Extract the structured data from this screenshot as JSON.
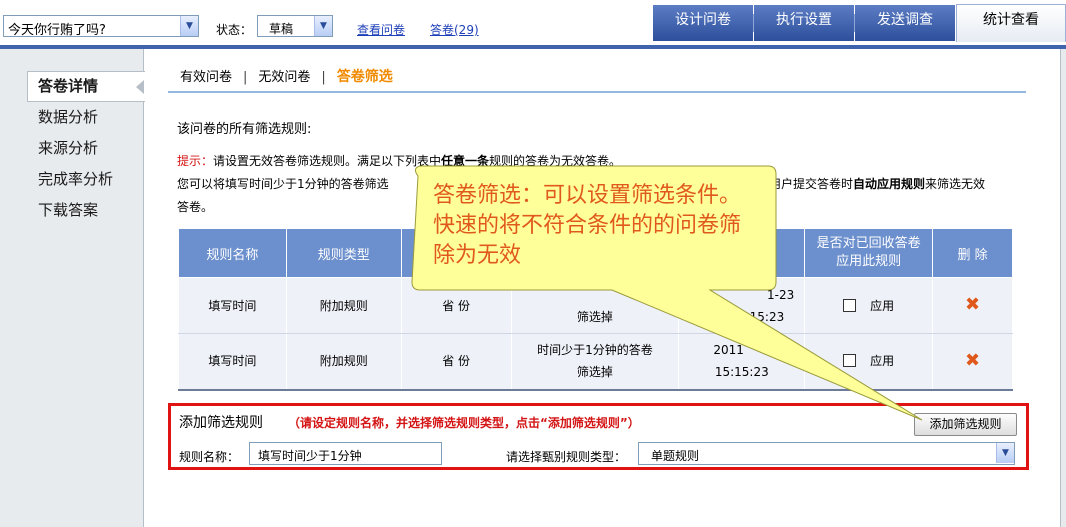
{
  "topbar": {
    "survey_select_value": "今天你行贿了吗?",
    "status_label": "状态：",
    "status_value": "草稿",
    "view_survey_link": "查看问卷",
    "answers_link": "答卷(29)",
    "tabs": [
      {
        "label": "设计问卷"
      },
      {
        "label": "执行设置"
      },
      {
        "label": "发送调查"
      },
      {
        "label": "统计查看"
      }
    ]
  },
  "sidebar": {
    "items": [
      {
        "label": "答卷详情"
      },
      {
        "label": "数据分析"
      },
      {
        "label": "来源分析"
      },
      {
        "label": "完成率分析"
      },
      {
        "label": "下载答案"
      }
    ]
  },
  "subtabs": [
    {
      "label": "有效问卷"
    },
    {
      "label": "无效问卷"
    },
    {
      "label": "答卷筛选"
    }
  ],
  "section_title": "该问卷的所有筛选规则:",
  "tip": {
    "label": "提示：",
    "line1_a": "请设置无效答卷筛选规则。满足以下列表中",
    "line1_b": "任意一条",
    "line1_c": "规则的答卷为无效答卷。",
    "line2_a": "您可以将填写时间少于1分钟的答卷筛选",
    "line2_b": "在用户提交答卷时",
    "line2_c": "自动应用规则",
    "line2_d": "来筛选无效",
    "line3": "答卷。"
  },
  "table": {
    "headers": [
      "规则名称",
      "规则类型",
      "",
      "",
      "",
      "是否对已回收答卷\n应用此规则",
      "删 除"
    ],
    "rows": [
      {
        "name": "填写时间",
        "type": "附加规则",
        "province": "省 份",
        "desc": "筛选掉",
        "time_top": "1-23",
        "time_bottom": "15:23",
        "apply": "应用",
        "delete": "✖"
      },
      {
        "name": "填写时间",
        "type": "附加规则",
        "province": "省 份",
        "desc": "时间少于1分钟的答卷\n筛选掉",
        "time_top": "2011",
        "time_bottom": "15:15:23",
        "apply": "应用",
        "delete": "✖"
      }
    ]
  },
  "add_rule": {
    "title": "添加筛选规则",
    "hint": "（请设定规则名称，并选择筛选规则类型，点击“添加筛选规则”）",
    "button": "添加筛选规则",
    "name_label": "规则名称：",
    "name_value": "填写时间少于1分钟",
    "type_label": "请选择甄别规则类型：",
    "type_value": "单题规则"
  },
  "callout": {
    "text": "答卷筛选：可以设置筛选条件。快速的将不符合条件的的问卷筛除为无效"
  },
  "colors": {
    "accent": "#3f63ad",
    "table_header": "#6c8fcd",
    "highlight_orange": "#f08a00",
    "callout_fill": "#ffff99",
    "warning_red": "#e11212"
  }
}
